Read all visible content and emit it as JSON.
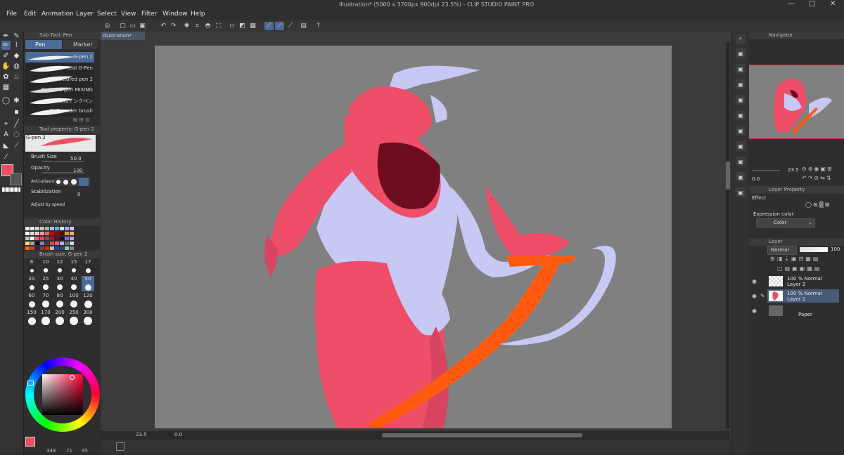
{
  "window": {
    "title": "Illustration* (5000 x 3700px 900dpi 23.5%) - CLIP STUDIO PAINT PRO",
    "controls": [
      "—",
      "□",
      "✕"
    ]
  },
  "menu": [
    "File",
    "Edit",
    "Animation",
    "Layer",
    "Select",
    "View",
    "Filter",
    "Window",
    "Help"
  ],
  "document_tab": "Illustration*",
  "subtool": {
    "header": "Sub Tool: Pen",
    "tabs": [
      "Pen",
      "Marker"
    ],
    "brushes": [
      "G-pen 2",
      "Real G-Pen",
      "Textured pen 2",
      "Textured pen MIXING",
      "ねねインクペン",
      "THE render brush"
    ]
  },
  "tool_property": {
    "header": "Tool property: G-pen 2",
    "brush_name": "G-pen 2",
    "brush_size_label": "Brush Size",
    "brush_size_value": "50.0",
    "opacity_label": "Opacity",
    "opacity_value": "100",
    "antialiasing_label": "Anti-aliasing",
    "stabilization_label": "Stabilization",
    "stabilization_value": "0",
    "adjust_label": "Adjust by speed"
  },
  "color_history": {
    "header": "Color History",
    "swatches": [
      "#f2f2f2",
      "#e6e6e6",
      "#d0d0d0",
      "#c4c4c4",
      "#b3b3b3",
      "#9fc5e8",
      "#6fa8dc",
      "#cfe2f3",
      "#a8a8f0",
      "#c9c9ff",
      "#ffffff",
      "#d9d9d9",
      "#f4cccc",
      "#ea9999",
      "#e06666",
      "#cc0000",
      "#990000",
      "#660000",
      "#e69138",
      "#f6b26b",
      "#c0c0c0",
      "#f9f9f9",
      "#ef5b73",
      "#d84560",
      "#b8344a",
      "#8a2030",
      "#5b1020",
      "#2a0a10",
      "#7b6bd6",
      "#b4a7d6",
      "#efe06a",
      "#a0a0a0",
      "#101010",
      "#8e7cc3",
      "#3c3c3c",
      "#f0405a",
      "#f06080",
      "#b0b0ff",
      "#666",
      "#d0d0ff",
      "#ff6a00",
      "#d04020",
      "#302060",
      "#804020",
      "#e02020",
      "#a8d080",
      "#2040c0",
      "#404060",
      "#70e0a0",
      "#888"
    ]
  },
  "brush_size": {
    "header": "Brush size: G-pen 2",
    "sizes": [
      "8",
      "10",
      "12",
      "15",
      "17",
      "20",
      "25",
      "30",
      "40",
      "50",
      "60",
      "70",
      "80",
      "100",
      "120",
      "150",
      "170",
      "200",
      "250",
      "300"
    ],
    "selected": "50"
  },
  "color_wheel": {
    "hue": "#ff0033",
    "main_color": "#ef4e69",
    "bottom_values": [
      "348",
      "71",
      "95"
    ]
  },
  "navigator": {
    "header": "Navigator",
    "zoom": "23.5",
    "rotation": "0.0"
  },
  "layer_property": {
    "header": "Layer Property",
    "effect_label": "Effect",
    "expression_color_label": "Expression color",
    "expression_color_value": "Color"
  },
  "layers": {
    "header": "Layer",
    "blend_mode": "Normal",
    "opacity": "100",
    "items": [
      {
        "line1": "100 % Normal",
        "line2": "Layer 2"
      },
      {
        "line1": "100 % Normal",
        "line2": "Layer 1"
      },
      {
        "line1": "",
        "line2": "Paper"
      }
    ]
  },
  "status": {
    "zoom": "23.5",
    "rotation": "0.0"
  },
  "colors": {
    "accent": "#4a6b95",
    "canvas_bg": "#808080",
    "red": "#ef4e69",
    "lavender": "#c8c8f5",
    "dark": "#7a0a22",
    "orange": "#ff5a10"
  }
}
